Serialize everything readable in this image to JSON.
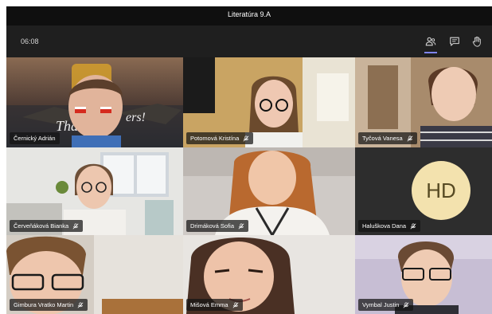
{
  "window": {
    "title": "Literatúra 9.A"
  },
  "toolbar": {
    "timer": "06:08",
    "icons": [
      "participants-icon",
      "chat-icon",
      "raise-hand-icon"
    ]
  },
  "participants": [
    {
      "name": "Černický Adrián",
      "muted": false
    },
    {
      "name": "Potomová Kristína",
      "muted": true
    },
    {
      "name": "Tyčová Vanesa",
      "muted": true
    },
    {
      "name": "Červeňáková Bianka",
      "muted": true
    },
    {
      "name": "Drimáková Sofia",
      "muted": true
    },
    {
      "name": "Haluškova Dana",
      "muted": true,
      "initials": "HD"
    },
    {
      "name": "Gimbura Vratko Martin",
      "muted": true
    },
    {
      "name": "Mišová Emma",
      "muted": true
    },
    {
      "name": "Vymbal Justin",
      "muted": true
    }
  ],
  "colors": {
    "app_background": "#1f1f1f",
    "titlebar": "#0f0f0f",
    "accent": "#7f85f5",
    "avatar_bg": "#f3e2ae",
    "avatar_fg": "#574a23"
  }
}
